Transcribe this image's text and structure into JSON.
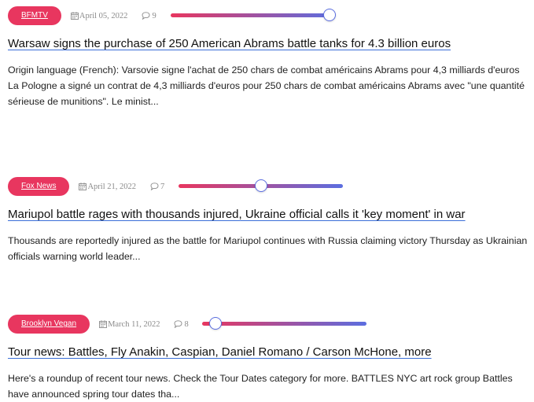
{
  "articles": [
    {
      "source": "BFMTV",
      "date": "April 05, 2022",
      "comments": "9",
      "slider_fraction": 0.97,
      "title": "Warsaw signs the purchase of 250 American Abrams battle tanks for 4.3 billion euros",
      "excerpt_line1": "Origin language (French): Varsovie signe l'achat de 250 chars de combat américains Abrams pour 4,3 milliards d'euros",
      "excerpt_line2": "La Pologne a signé un contrat de 4,3 milliards d'euros pour 250 chars de combat américains Abrams avec \"une quantité sérieuse de munitions\". Le minist..."
    },
    {
      "source": "Fox News",
      "date": "April 21, 2022",
      "comments": "7",
      "slider_fraction": 0.5,
      "title": "Mariupol battle rages with thousands injured, Ukraine official calls it 'key moment' in war",
      "excerpt_line1": "Thousands are reportedly injured as the battle for Mariupol continues with Russia claiming victory Thursday as Ukrainian officials warning world leader..."
    },
    {
      "source": "Brooklyn Vegan",
      "date": "March 11, 2022",
      "comments": "8",
      "slider_fraction": 0.08,
      "title": "Tour news: Battles, Fly Anakin, Caspian, Daniel Romano / Carson McHone, more",
      "excerpt_line1": "Here's a roundup of recent tour news. Check the Tour Dates category for more. BATTLES NYC art rock group Battles have announced spring tour dates tha..."
    }
  ],
  "colors": {
    "badge": "#e8365f",
    "gradient_start": "#e8365f",
    "gradient_end": "#5b6ee0",
    "title_underline": "#3b6fd8"
  },
  "icons": {
    "date": "calendar-icon",
    "comments": "comment-icon"
  }
}
